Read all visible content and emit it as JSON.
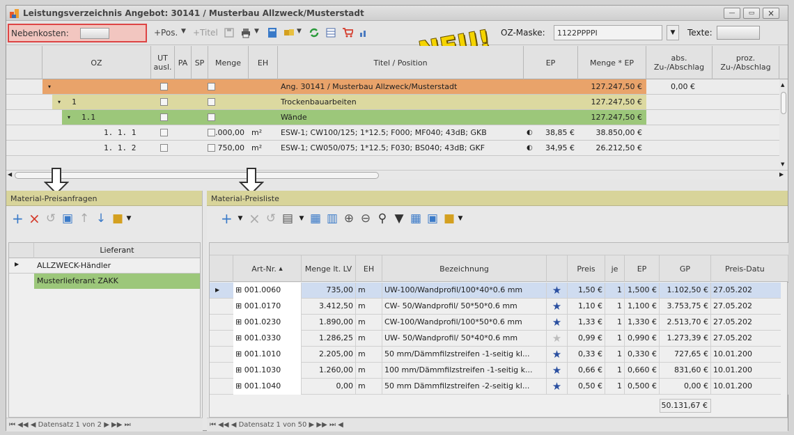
{
  "window": {
    "title": "Leistungsverzeichnis Angebot: 30141 / Musterbau Allzweck/Musterstadt",
    "min": "—",
    "max": "▭",
    "close": "×"
  },
  "toolbar": {
    "nebenkosten": "Nebenkosten:",
    "pos": "+Pos.",
    "titel": "+Titel",
    "oz_mask_label": "OZ-Maske:",
    "oz_mask_value": "1122PPPPI",
    "texte": "Texte:",
    "neu": "NEU!"
  },
  "top_columns": {
    "oz": "OZ",
    "ut": "UT ausl.",
    "pa": "PA",
    "sp": "SP",
    "menge": "Menge",
    "eh": "EH",
    "titel": "Titel / Position",
    "ep": "EP",
    "menge_ep": "Menge * EP",
    "abs": "abs. Zu-/Abschlag",
    "proz": "proz. Zu-/Abschlag"
  },
  "top_rows": [
    {
      "oz": "",
      "menge": "",
      "eh": "",
      "titel": "Ang. 30141 / Musterbau Allzweck/Musterstadt",
      "ep": "",
      "menge_ep": "127.247,50 €",
      "abs": "0,00 €",
      "color": "#e9a36a"
    },
    {
      "oz": "1",
      "menge": "",
      "eh": "",
      "titel": "Trockenbauarbeiten",
      "ep": "",
      "menge_ep": "127.247,50 €",
      "abs": "",
      "color": "#dcd9a0"
    },
    {
      "oz": "1.1",
      "menge": "",
      "eh": "",
      "titel": "Wände",
      "ep": "",
      "menge_ep": "127.247,50 €",
      "abs": "",
      "color": "#9cc77a"
    },
    {
      "oz": "1. 1.  1",
      "menge": "1.000,00",
      "eh": "m²",
      "titel": "ESW-1; CW100/125; 1*12.5; F000; MF040; 43dB; GKB",
      "ep": "38,85 €",
      "menge_ep": "38.850,00 €",
      "abs": "",
      "color": "#ececec"
    },
    {
      "oz": "1. 1.  2",
      "menge": "750,00",
      "eh": "m²",
      "titel": "ESW-1; CW050/075; 1*12.5; F030; BS040; 43dB; GKF",
      "ep": "34,95 €",
      "menge_ep": "26.212,50 €",
      "abs": "",
      "color": "#ececec"
    }
  ],
  "left_panel": {
    "title": "Material-Preisanfragen",
    "column": "Lieferant",
    "rows": [
      "ALLZWECK-Händler",
      "Musterlieferant ZAKK"
    ],
    "nav": "Datensatz 1 von 2"
  },
  "right_panel": {
    "title": "Material-Preisliste",
    "columns": {
      "art": "Art-Nr.",
      "menge": "Menge lt. LV",
      "eh": "EH",
      "bez": "Bezeichnung",
      "preis": "Preis",
      "je": "je",
      "ep": "EP",
      "gp": "GP",
      "datum": "Preis-Datu"
    },
    "rows": [
      {
        "art": "001.0060",
        "menge": "735,00",
        "eh": "m",
        "bez": "UW-100/Wandprofil/100*40*0.6 mm",
        "preis": "1,50 €",
        "je": "1",
        "ep": "1,500 €",
        "gp": "1.102,50 €",
        "datum": "27.05.202",
        "star": "★",
        "starColor": "#2a4fa0"
      },
      {
        "art": "001.0170",
        "menge": "3.412,50",
        "eh": "m",
        "bez": "CW- 50/Wandprofil/ 50*50*0.6 mm",
        "preis": "1,10 €",
        "je": "1",
        "ep": "1,100 €",
        "gp": "3.753,75 €",
        "datum": "27.05.202",
        "star": "★",
        "starColor": "#2a4fa0"
      },
      {
        "art": "001.0230",
        "menge": "1.890,00",
        "eh": "m",
        "bez": "CW-100/Wandprofil/100*50*0.6 mm",
        "preis": "1,33 €",
        "je": "1",
        "ep": "1,330 €",
        "gp": "2.513,70 €",
        "datum": "27.05.202",
        "star": "★",
        "starColor": "#2a4fa0"
      },
      {
        "art": "001.0330",
        "menge": "1.286,25",
        "eh": "m",
        "bez": "UW- 50/Wandprofil/ 50*40*0.6 mm",
        "preis": "0,99 €",
        "je": "1",
        "ep": "0,990 €",
        "gp": "1.273,39 €",
        "datum": "27.05.202",
        "star": "★",
        "starColor": "#bcbcbc"
      },
      {
        "art": "001.1010",
        "menge": "2.205,00",
        "eh": "m",
        "bez": "50 mm/Dämmfilzstreifen  -1-seitig kl...",
        "preis": "0,33 €",
        "je": "1",
        "ep": "0,330 €",
        "gp": "727,65 €",
        "datum": "10.01.200",
        "star": "★",
        "starColor": "#2a4fa0"
      },
      {
        "art": "001.1030",
        "menge": "1.260,00",
        "eh": "m",
        "bez": "100 mm/Dämmfilzstreifen  -1-seitig k...",
        "preis": "0,66 €",
        "je": "1",
        "ep": "0,660 €",
        "gp": "831,60 €",
        "datum": "10.01.200",
        "star": "★",
        "starColor": "#2a4fa0"
      },
      {
        "art": "001.1040",
        "menge": "0,00",
        "eh": "m",
        "bez": "50 mm Dämmfilzstreifen  -2-seitig kl...",
        "preis": "0,50 €",
        "je": "1",
        "ep": "0,500 €",
        "gp": "0,00 €",
        "datum": "10.01.200",
        "star": "★",
        "starColor": "#2a4fa0"
      }
    ],
    "total": "50.131,67 €",
    "nav": "Datensatz 1 von 50"
  }
}
